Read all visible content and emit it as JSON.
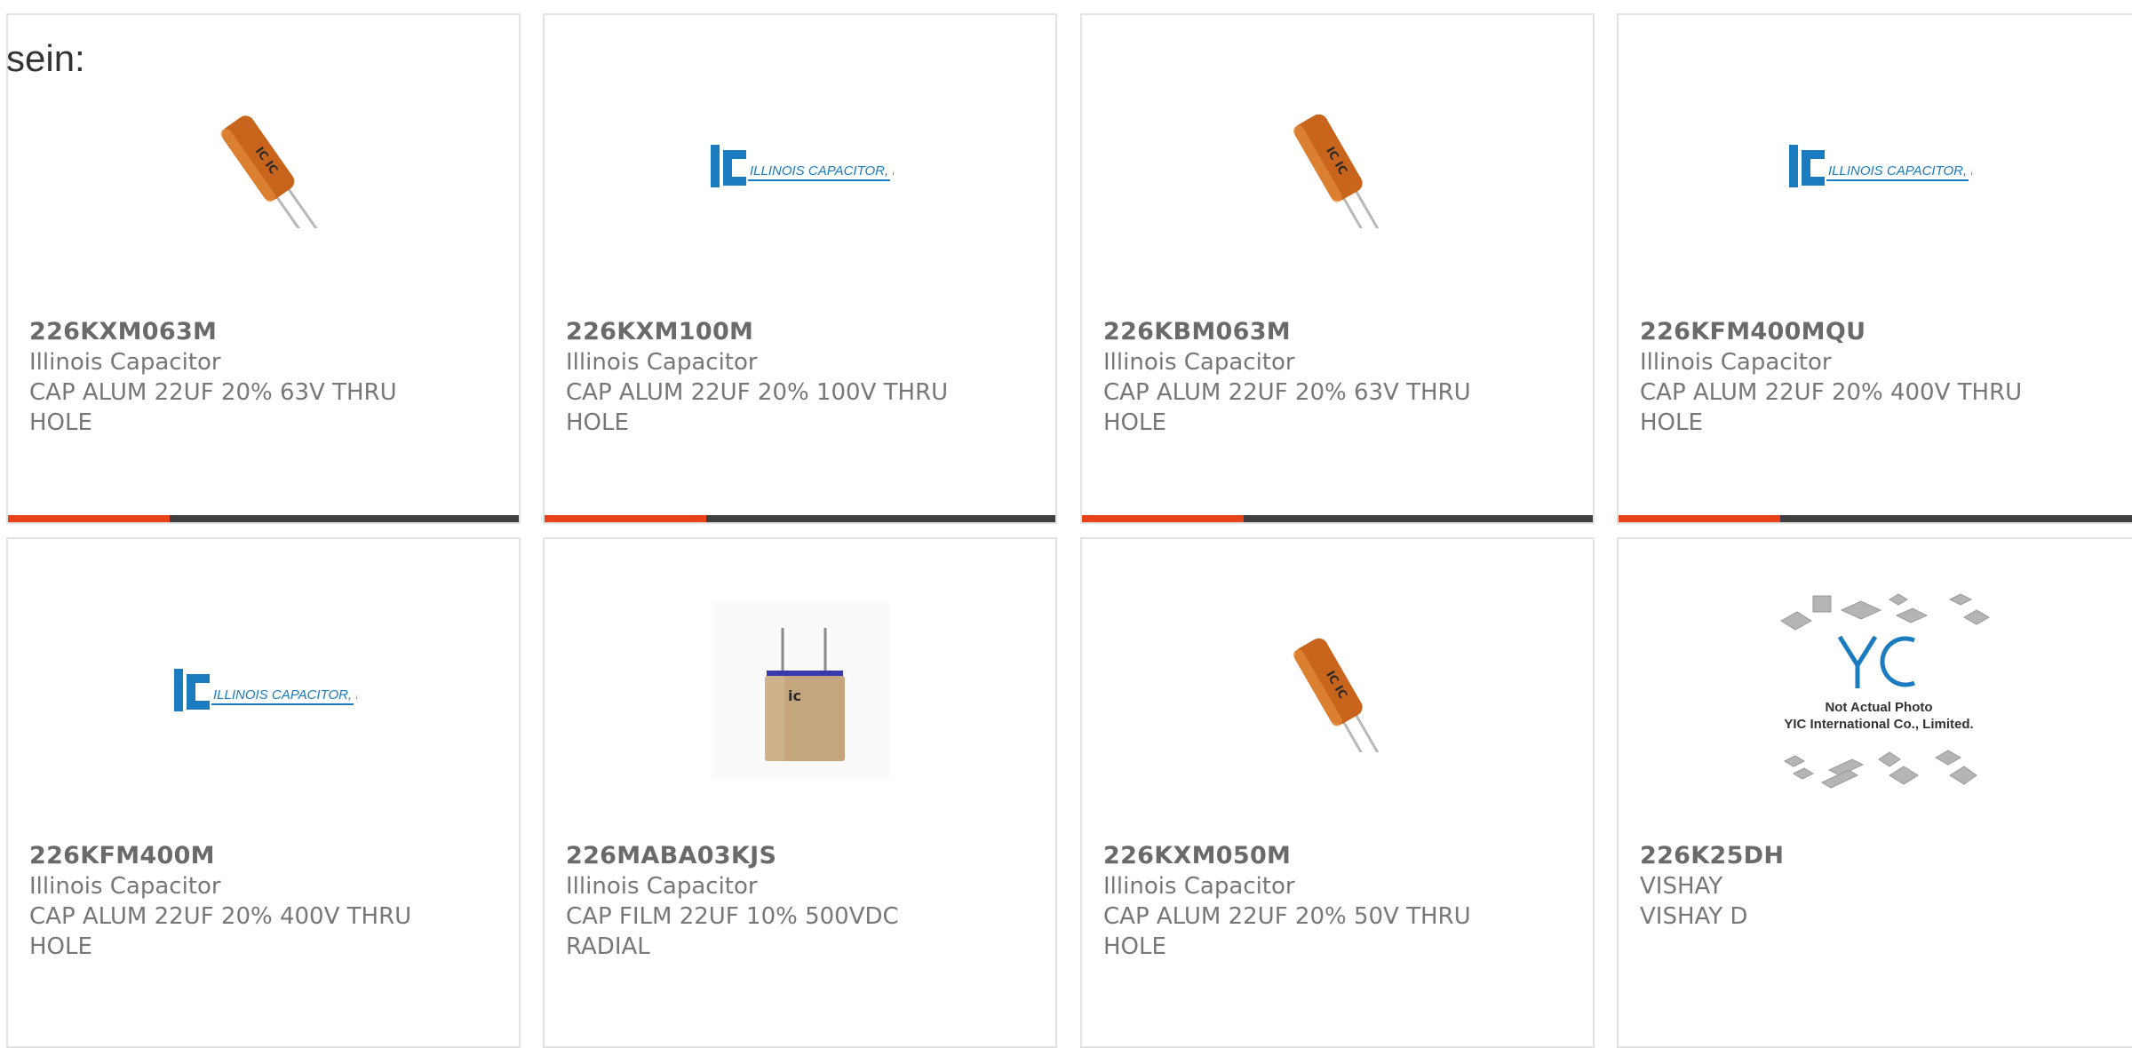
{
  "intro_text": "sein:",
  "products": [
    {
      "part": "226KXM063M",
      "manufacturer": "Illinois Capacitor",
      "description": "CAP ALUM 22UF 20% 63V THRU HOLE",
      "image": "electrolytic-capacitor-photo",
      "accent": "#e8421b"
    },
    {
      "part": "226KXM100M",
      "manufacturer": "Illinois Capacitor",
      "description": "CAP ALUM 22UF 20% 100V THRU HOLE",
      "image": "illinois-capacitor-logo",
      "logo_text": "ILLINOIS CAPACITOR, INC.",
      "accent": "#e8421b"
    },
    {
      "part": "226KBM063M",
      "manufacturer": "Illinois Capacitor",
      "description": "CAP ALUM 22UF 20% 63V THRU HOLE",
      "image": "electrolytic-capacitor-photo",
      "accent": "#e8421b"
    },
    {
      "part": "226KFM400MQU",
      "manufacturer": "Illinois Capacitor",
      "description": "CAP ALUM 22UF 20% 400V THRU HOLE",
      "image": "illinois-capacitor-logo",
      "logo_text": "ILLINOIS CAPACITOR, INC.",
      "accent": "#e8421b"
    },
    {
      "part": "226KFM400M",
      "manufacturer": "Illinois Capacitor",
      "description": "CAP ALUM 22UF 20% 400V THRU HOLE",
      "image": "illinois-capacitor-logo",
      "logo_text": "ILLINOIS CAPACITOR, INC."
    },
    {
      "part": "226MABA03KJS",
      "manufacturer": "Illinois Capacitor",
      "description": "CAP FILM 22UF 10% 500VDC RADIAL",
      "image": "film-capacitor-photo"
    },
    {
      "part": "226KXM050M",
      "manufacturer": "Illinois Capacitor",
      "description": "CAP ALUM 22UF 20% 50V THRU HOLE",
      "image": "electrolytic-capacitor-photo"
    },
    {
      "part": "226K25DH",
      "manufacturer": "VISHAY",
      "description": "VISHAY D",
      "image": "yic-not-actual-photo",
      "placeholder_text_1": "Not Actual Photo",
      "placeholder_text_2": "YIC International Co., Limited."
    }
  ],
  "colors": {
    "accent": "#e8421b",
    "bar": "#3f3f3f",
    "logo_blue": "#1a7bbf",
    "capacitor_orange": "#c9641c"
  }
}
